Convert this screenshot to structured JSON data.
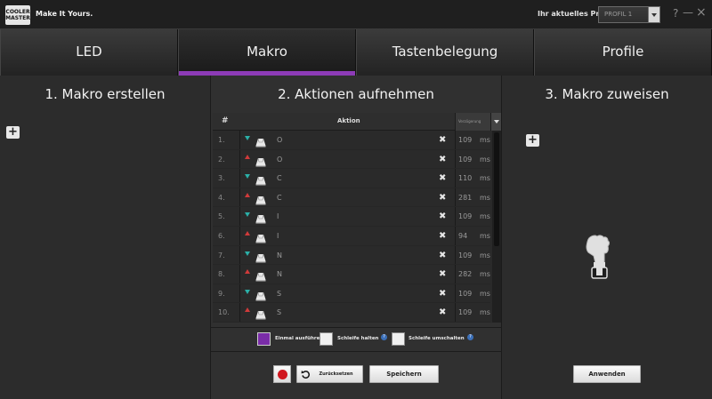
{
  "app": {
    "logo_text": "COOLER MASTER",
    "tagline": "Make It Yours.",
    "profile_label": "Ihr aktuelles Profil",
    "profile_value": "PROFIL 1",
    "help": "?",
    "minimize": "—",
    "close": "×"
  },
  "tabs": [
    {
      "label": "LED"
    },
    {
      "label": "Makro"
    },
    {
      "label": "Tastenbelegung"
    },
    {
      "label": "Profile"
    }
  ],
  "active_tab": "Makro",
  "panels": {
    "create_title": "1. Makro erstellen",
    "record_title": "2. Aktionen aufnehmen",
    "assign_title": "3. Makro zuweisen",
    "plus": "+"
  },
  "table": {
    "col_num": "#",
    "col_action": "Aktion",
    "col_delay": "Verzögerung",
    "rows": [
      {
        "num": "1.",
        "dir": "down",
        "key": "O",
        "delay": "109",
        "unit": "ms"
      },
      {
        "num": "2.",
        "dir": "up",
        "key": "O",
        "delay": "109",
        "unit": "ms"
      },
      {
        "num": "3.",
        "dir": "down",
        "key": "C",
        "delay": "110",
        "unit": "ms"
      },
      {
        "num": "4.",
        "dir": "up",
        "key": "C",
        "delay": "281",
        "unit": "ms"
      },
      {
        "num": "5.",
        "dir": "down",
        "key": "I",
        "delay": "109",
        "unit": "ms"
      },
      {
        "num": "6.",
        "dir": "up",
        "key": "I",
        "delay": "94",
        "unit": "ms"
      },
      {
        "num": "7.",
        "dir": "down",
        "key": "N",
        "delay": "109",
        "unit": "ms"
      },
      {
        "num": "8.",
        "dir": "up",
        "key": "N",
        "delay": "282",
        "unit": "ms"
      },
      {
        "num": "9.",
        "dir": "down",
        "key": "S",
        "delay": "109",
        "unit": "ms"
      },
      {
        "num": "10.",
        "dir": "up",
        "key": "S",
        "delay": "109",
        "unit": "ms"
      }
    ],
    "delete_glyph": "✖"
  },
  "options": {
    "once": "Einmal ausführen",
    "loop_hold": "Schleife halten",
    "loop_toggle": "Schleife umschalten",
    "info_glyph": "?"
  },
  "buttons": {
    "reset": "Zurücksetzen",
    "save": "Speichern",
    "apply": "Anwenden"
  },
  "colors": {
    "accent": "#8d3bb7",
    "key_down": "#2bb0a8",
    "key_up": "#d03a3a",
    "record": "#d0161e"
  }
}
